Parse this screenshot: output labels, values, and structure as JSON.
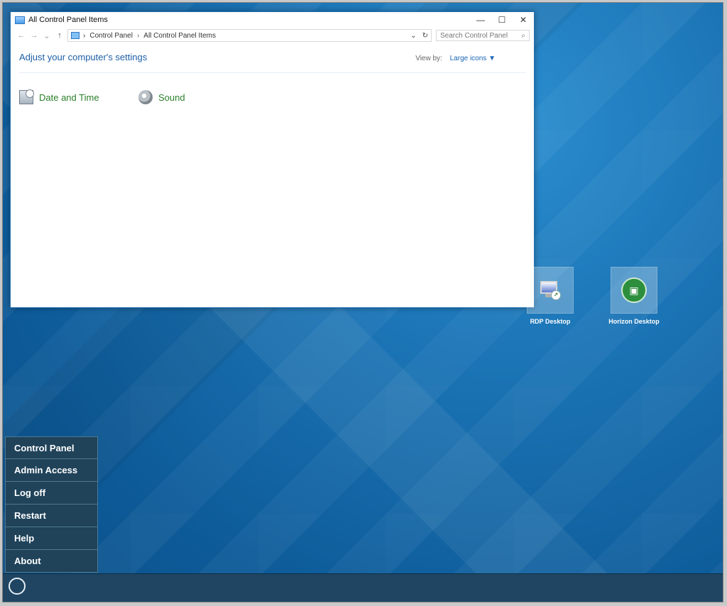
{
  "window": {
    "title": "All Control Panel Items",
    "breadcrumb": [
      "Control Panel",
      "All Control Panel Items"
    ],
    "search_placeholder": "Search Control Panel",
    "heading": "Adjust your computer's settings",
    "view_by_label": "View by:",
    "view_by_value": "Large icons",
    "items": [
      {
        "label": "Date and Time",
        "icon": "date-time-icon"
      },
      {
        "label": "Sound",
        "icon": "sound-icon"
      }
    ]
  },
  "desktop": {
    "icons": [
      {
        "label": "RDP Desktop",
        "icon": "rdp-desktop-icon"
      },
      {
        "label": "Horizon Desktop",
        "icon": "horizon-desktop-icon"
      }
    ]
  },
  "start_menu": {
    "items": [
      "Control Panel",
      "Admin Access",
      "Log off",
      "Restart",
      "Help",
      "About"
    ]
  },
  "taskbar": {
    "start_button_icon": "start-orb-icon"
  }
}
